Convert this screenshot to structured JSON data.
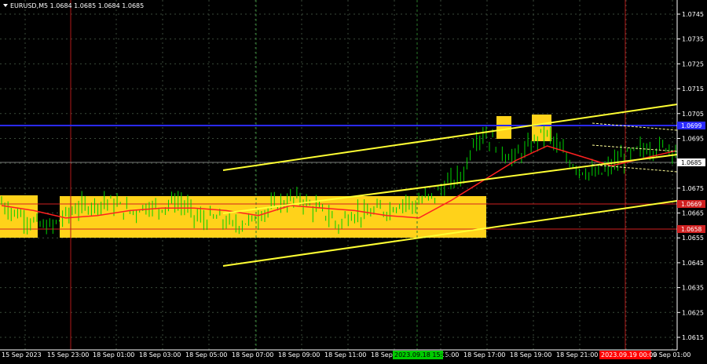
{
  "header": {
    "triangle_icon": "down-triangle-icon",
    "symbol_text": "EURUSD,M5  1.0684 1.0685 1.0684 1.0685"
  },
  "colors": {
    "background": "#000000",
    "grid": "#3a4a3a",
    "candle": "#00d000",
    "ma": "#ff2020",
    "channel": "#ffff33",
    "zone": "#ffd21a",
    "level_blue": "#2a2aff",
    "level_red": "#d02020",
    "vline_red": "#b01818",
    "vline_green": "#2a7a2a"
  },
  "chart_data": {
    "type": "candlestick",
    "y_ticks": [
      "1.0745",
      "1.0735",
      "1.0725",
      "1.0715",
      "1.0705",
      "1.0695",
      "1.0685",
      "1.0675",
      "1.0665",
      "1.0655",
      "1.0645",
      "1.0635",
      "1.0625",
      "1.0615"
    ],
    "ylim": [
      1.061,
      1.0752
    ],
    "x_ticks": [
      "15 Sep 2023",
      "15 Sep 23:00",
      "18 Sep 01:00",
      "18 Sep 03:00",
      "18 Sep 05:00",
      "18 Sep 07:00",
      "18 Sep 09:00",
      "18 Sep 11:00",
      "18 Sep 13:00",
      "18 Sep 15:00",
      "18 Sep 17:00",
      "18 Sep 19:00",
      "18 Sep 21:00",
      "18 Sep 23:00",
      "19 Sep 01:00"
    ],
    "highlight_time_label": "2023.09.18 15:00",
    "highlight_time_color": "#00cc00",
    "highlight_time_label2": "2023.09.19 00:00",
    "highlight_time_color2": "#ff0000",
    "close_path": [
      [
        0,
        1.0669
      ],
      [
        3,
        1.0666
      ],
      [
        6,
        1.0664
      ],
      [
        9,
        1.0662
      ],
      [
        12,
        1.066
      ],
      [
        15,
        1.0659
      ],
      [
        18,
        1.0662
      ],
      [
        21,
        1.0665
      ],
      [
        24,
        1.0667
      ],
      [
        27,
        1.0668
      ],
      [
        30,
        1.0669
      ],
      [
        33,
        1.067
      ],
      [
        36,
        1.0668
      ],
      [
        39,
        1.0666
      ],
      [
        42,
        1.0666
      ],
      [
        45,
        1.0668
      ],
      [
        48,
        1.0667
      ],
      [
        51,
        1.0668
      ],
      [
        54,
        1.067
      ],
      [
        57,
        1.0668
      ],
      [
        60,
        1.0664
      ],
      [
        63,
        1.0662
      ],
      [
        66,
        1.0663
      ],
      [
        69,
        1.0662
      ],
      [
        72,
        1.066
      ],
      [
        75,
        1.0661
      ],
      [
        78,
        1.0662
      ],
      [
        81,
        1.0665
      ],
      [
        84,
        1.0667
      ],
      [
        87,
        1.0669
      ],
      [
        90,
        1.067
      ],
      [
        93,
        1.0671
      ],
      [
        96,
        1.0668
      ],
      [
        99,
        1.0666
      ],
      [
        102,
        1.0664
      ],
      [
        105,
        1.066
      ],
      [
        108,
        1.0664
      ],
      [
        111,
        1.0665
      ],
      [
        114,
        1.0664
      ],
      [
        117,
        1.0666
      ],
      [
        120,
        1.0666
      ],
      [
        123,
        1.0668
      ],
      [
        126,
        1.067
      ],
      [
        129,
        1.0668
      ],
      [
        132,
        1.0671
      ],
      [
        135,
        1.0672
      ],
      [
        138,
        1.0676
      ],
      [
        141,
        1.0678
      ],
      [
        144,
        1.0681
      ],
      [
        147,
        1.0694
      ],
      [
        150,
        1.0697
      ],
      [
        153,
        1.0694
      ],
      [
        156,
        1.069
      ],
      [
        159,
        1.0687
      ],
      [
        162,
        1.0689
      ],
      [
        165,
        1.0692
      ],
      [
        168,
        1.0697
      ],
      [
        171,
        1.0696
      ],
      [
        174,
        1.069
      ],
      [
        177,
        1.0686
      ],
      [
        180,
        1.0683
      ],
      [
        183,
        1.0681
      ],
      [
        186,
        1.068
      ],
      [
        189,
        1.0683
      ],
      [
        192,
        1.0686
      ],
      [
        195,
        1.0688
      ],
      [
        198,
        1.069
      ],
      [
        201,
        1.0691
      ],
      [
        204,
        1.0691
      ],
      [
        207,
        1.0692
      ],
      [
        210,
        1.0691
      ]
    ],
    "ma_path": [
      [
        0,
        1.0668
      ],
      [
        10,
        1.0666
      ],
      [
        20,
        1.0663
      ],
      [
        30,
        1.0664
      ],
      [
        40,
        1.0666
      ],
      [
        50,
        1.0667
      ],
      [
        60,
        1.0667
      ],
      [
        70,
        1.0666
      ],
      [
        80,
        1.0664
      ],
      [
        90,
        1.0668
      ],
      [
        100,
        1.0667
      ],
      [
        110,
        1.0666
      ],
      [
        120,
        1.0664
      ],
      [
        130,
        1.0663
      ],
      [
        140,
        1.067
      ],
      [
        150,
        1.0678
      ],
      [
        160,
        1.0686
      ],
      [
        170,
        1.0692
      ],
      [
        180,
        1.0688
      ],
      [
        190,
        1.0684
      ],
      [
        200,
        1.0687
      ],
      [
        210,
        1.069
      ]
    ],
    "levels": [
      {
        "price_label": "1.0699",
        "price": 1.0699,
        "color": "blue"
      },
      {
        "price_label": "1.0669",
        "price": 1.0669,
        "color": "red"
      },
      {
        "price_label": "1.0658",
        "price": 1.0658,
        "color": "red"
      },
      {
        "price_label": "1.0685",
        "price": 1.0685,
        "color": "bid"
      }
    ]
  }
}
